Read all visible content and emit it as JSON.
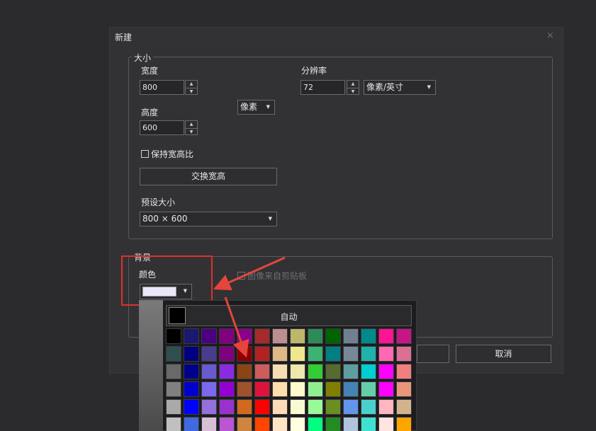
{
  "dialog": {
    "title": "新建",
    "close_label": "×",
    "size_group": {
      "legend": "大小",
      "width_label": "宽度",
      "width_value": "800",
      "height_label": "高度",
      "height_value": "600",
      "unit_select": "像素",
      "resolution_label": "分辨率",
      "resolution_value": "72",
      "resolution_unit": "像素/英寸",
      "keep_ratio_label": "保持宽高比",
      "swap_button": "交换宽高",
      "preset_label": "预设大小",
      "preset_value": "800 × 600"
    },
    "background_group": {
      "legend": "背景",
      "color_label": "颜色",
      "color_value": "#e8e8f8",
      "clipboard_label": "图像来自剪贴板"
    },
    "cancel_button": "取消"
  },
  "color_popup": {
    "auto_label": "自动",
    "rows": [
      [
        "#000000",
        "#191970",
        "#4b0082",
        "#800080",
        "#8b008b",
        "#a52a2a",
        "#bc8f8f",
        "#bdb76b",
        "#2e8b57",
        "#006400",
        "#708090",
        "#008b8b",
        "#ff1493",
        "#c71585"
      ],
      [
        "#2f4f4f",
        "#000080",
        "#483d8b",
        "#800080",
        "#8b0000",
        "#b22222",
        "#deb887",
        "#f0e68c",
        "#3cb371",
        "#008080",
        "#778899",
        "#20b2aa",
        "#ff69b4",
        "#db7093"
      ],
      [
        "#696969",
        "#00008b",
        "#6a5acd",
        "#8a2be2",
        "#8b4513",
        "#cd5c5c",
        "#f5deb3",
        "#eee8aa",
        "#32cd32",
        "#556b2f",
        "#5f9ea0",
        "#00ced1",
        "#ff00ff",
        "#f08080"
      ],
      [
        "#808080",
        "#0000cd",
        "#7b68ee",
        "#9400d3",
        "#a0522d",
        "#dc143c",
        "#ffdead",
        "#fffacd",
        "#90ee90",
        "#808000",
        "#4682b4",
        "#66cdaa",
        "#ff00ff",
        "#e9967a"
      ],
      [
        "#a9a9a9",
        "#0000ff",
        "#9370db",
        "#9932cc",
        "#d2691e",
        "#ff0000",
        "#ffdab9",
        "#fafad2",
        "#98fb98",
        "#6b8e23",
        "#6495ed",
        "#48d1cc",
        "#ffb6c1",
        "#d2b48c"
      ],
      [
        "#c0c0c0",
        "#4169e1",
        "#d8bfd8",
        "#ba55d3",
        "#cd853f",
        "#ff4500",
        "#ffe4c4",
        "#ffffe0",
        "#00ff7f",
        "#228b22",
        "#b0c4de",
        "#40e0d0",
        "#ffe4e1",
        "#ffa500"
      ]
    ]
  }
}
